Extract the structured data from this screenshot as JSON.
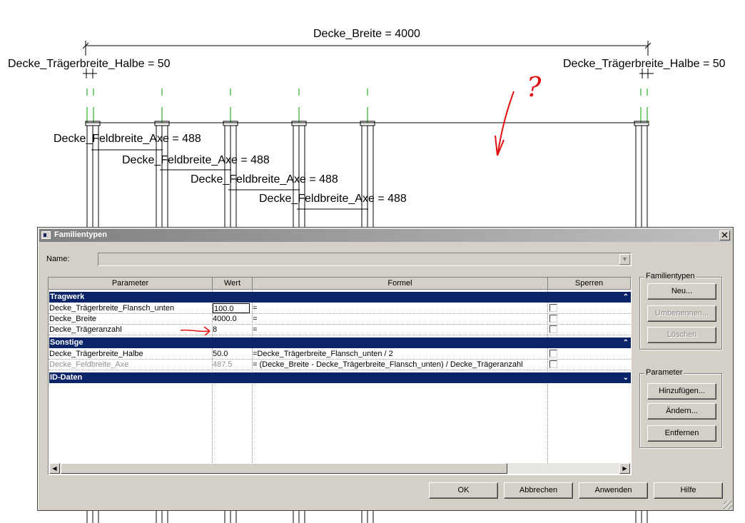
{
  "drawing": {
    "dim_breite": "Decke_Breite = 4000",
    "dim_halbe_left": "Decke_Trägerbreite_Halbe = 50",
    "dim_halbe_right": "Decke_Trägerbreite_Halbe = 50",
    "dim_feld_1": "Decke_Feldbreite_Axe = 488",
    "dim_feld_2": "Decke_Feldbreite_Axe = 488",
    "dim_feld_3": "Decke_Feldbreite_Axe = 488",
    "dim_feld_4": "Decke_Feldbreite_Axe = 488",
    "annotation_mark": "?",
    "annotation_color": "#e01010"
  },
  "dialog": {
    "title": "Familientypen",
    "close_glyph": "✕",
    "name_label": "Name:",
    "name_value": "",
    "columns": [
      "Parameter",
      "Wert",
      "Formel",
      "Sperren"
    ],
    "groups": [
      {
        "label": "Tragwerk",
        "rows": [
          {
            "parameter": "Decke_Trägerbreite_Flansch_unten",
            "wert": "100.0",
            "formel": "=",
            "locked": false
          },
          {
            "parameter": "Decke_Breite",
            "wert": "4000.0",
            "formel": "=",
            "locked": false
          },
          {
            "parameter": "Decke_Trägeranzahl",
            "wert": "8",
            "formel": "=",
            "locked": false
          }
        ]
      },
      {
        "label": "Sonstige",
        "rows": [
          {
            "parameter": "Decke_Trägerbreite_Halbe",
            "wert": "50.0",
            "formel": "=Decke_Trägerbreite_Flansch_unten / 2",
            "locked": false
          },
          {
            "parameter": "Decke_Feldbreite_Axe",
            "wert": "487.5",
            "formel": "= (Decke_Breite - Decke_Trägerbreite_Flansch_unten) / Decke_Trägeranzahl",
            "locked": false
          }
        ]
      },
      {
        "label": "ID-Daten",
        "rows": []
      }
    ],
    "familientypen_group": {
      "legend": "Familientypen",
      "neu": "Neu...",
      "umbenennen": "Umbenennen...",
      "loeschen": "Löschen"
    },
    "parameter_group": {
      "legend": "Parameter",
      "hinzufuegen": "Hinzufügen...",
      "aendern": "Ändern...",
      "entfernen": "Entfernen"
    },
    "buttons": {
      "ok": "OK",
      "abbrechen": "Abbrechen",
      "anwenden": "Anwenden",
      "hilfe": "Hilfe"
    },
    "colors": {
      "group_header_bg": "#0a246a",
      "dialog_bg": "#d4d0c8"
    }
  }
}
